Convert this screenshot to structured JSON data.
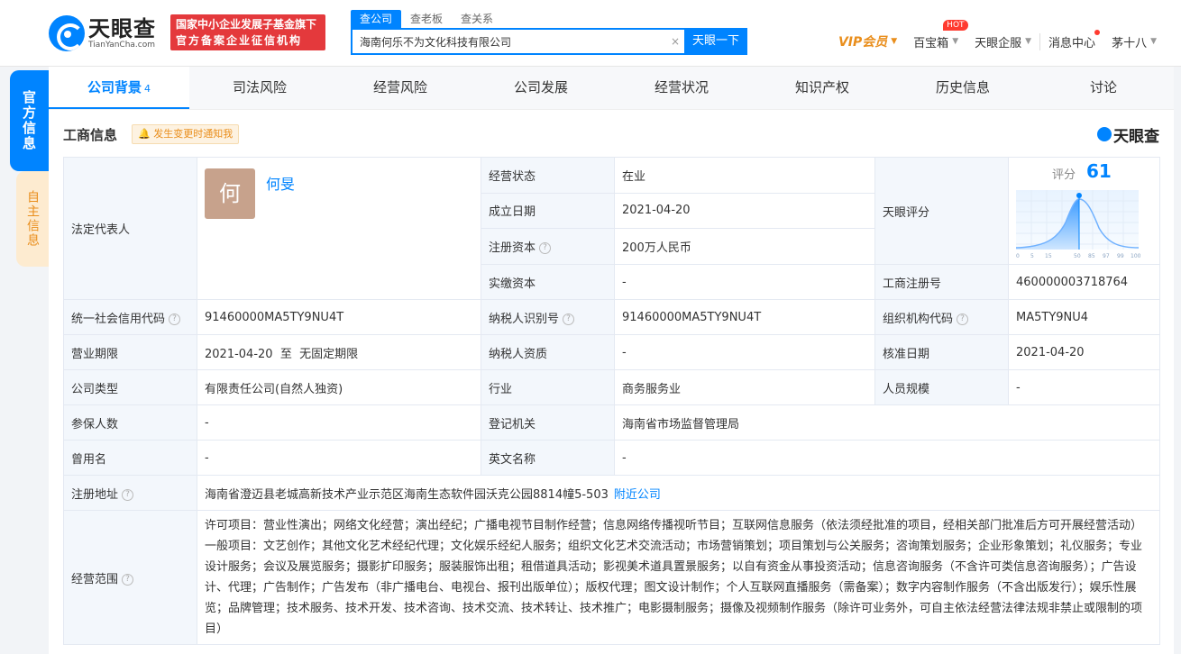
{
  "header": {
    "logo_cn": "天眼查",
    "logo_en": "TianYanCha.com",
    "badge_line1": "国家中小企业发展子基金旗下",
    "badge_line2": "官方备案企业征信机构",
    "search_tabs": [
      "查公司",
      "查老板",
      "查关系"
    ],
    "search_value": "海南何乐不为文化科技有限公司",
    "search_clear": "×",
    "search_button": "天眼一下",
    "vip": "VIP会员",
    "treasure": "百宝箱",
    "hot": "HOT",
    "enterprise": "天眼企服",
    "messages": "消息中心",
    "user": "茅十八"
  },
  "side": {
    "official": "官方信息",
    "self": "自主信息"
  },
  "tabs": [
    {
      "label": "公司背景",
      "count": "4"
    },
    {
      "label": "司法风险"
    },
    {
      "label": "经营风险"
    },
    {
      "label": "公司发展"
    },
    {
      "label": "经营状况"
    },
    {
      "label": "知识产权"
    },
    {
      "label": "历史信息"
    },
    {
      "label": "讨论"
    }
  ],
  "section": {
    "title": "工商信息",
    "notify": "发生变更时通知我",
    "brand": "天眼查"
  },
  "info": {
    "legal_rep_label": "法定代表人",
    "avatar_char": "何",
    "legal_rep_name": "何旻",
    "status_label": "经营状态",
    "status": "在业",
    "established_label": "成立日期",
    "established": "2021-04-20",
    "capital_label": "注册资本",
    "capital": "200万人民币",
    "paid_label": "实缴资本",
    "paid": "-",
    "score_label": "天眼评分",
    "score_title": "评分",
    "score_value": "61",
    "score_ticks": [
      "0",
      "5",
      "15",
      "50",
      "85",
      "97",
      "99",
      "100"
    ],
    "reg_no_label": "工商注册号",
    "reg_no": "460000003718764",
    "credit_label": "统一社会信用代码",
    "credit": "91460000MA5TY9NU4T",
    "taxpayer_label": "纳税人识别号",
    "taxpayer": "91460000MA5TY9NU4T",
    "org_label": "组织机构代码",
    "org": "MA5TY9NU4",
    "term_label": "营业期限",
    "term": "2021-04-20  至  无固定期限",
    "tax_qual_label": "纳税人资质",
    "tax_qual": "-",
    "approved_label": "核准日期",
    "approved": "2021-04-20",
    "type_label": "公司类型",
    "type": "有限责任公司(自然人独资)",
    "industry_label": "行业",
    "industry": "商务服务业",
    "staff_label": "人员规模",
    "staff": "-",
    "insured_label": "参保人数",
    "insured": "-",
    "authority_label": "登记机关",
    "authority": "海南省市场监督管理局",
    "former_label": "曾用名",
    "former": "-",
    "english_label": "英文名称",
    "english": "-",
    "address_label": "注册地址",
    "address": "海南省澄迈县老城高新技术产业示范区海南生态软件园沃克公园8814幢5-503",
    "nearby": "附近公司",
    "scope_label": "经营范围",
    "scope": "许可项目：营业性演出；网络文化经营；演出经纪；广播电视节目制作经营；信息网络传播视听节目；互联网信息服务（依法须经批准的项目，经相关部门批准后方可开展经营活动）一般项目：文艺创作；其他文化艺术经纪代理；文化娱乐经纪人服务；组织文化艺术交流活动；市场营销策划；项目策划与公关服务；咨询策划服务；企业形象策划；礼仪服务；专业设计服务；会议及展览服务；摄影扩印服务；服装服饰出租；租借道具活动；影视美术道具置景服务；以自有资金从事投资活动；信息咨询服务（不含许可类信息咨询服务）；广告设计、代理；广告制作；广告发布（非广播电台、电视台、报刊出版单位）；版权代理；图文设计制作；个人互联网直播服务（需备案）；数字内容制作服务（不含出版发行）；娱乐性展览；品牌管理；技术服务、技术开发、技术咨询、技术交流、技术转让、技术推广；电影摄制服务；摄像及视频制作服务（除许可业务外，可自主依法经营法律法规非禁止或限制的项目）"
  }
}
